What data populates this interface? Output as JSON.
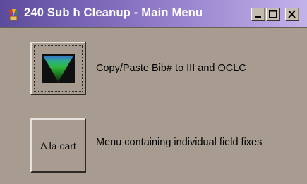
{
  "window": {
    "title": "240 Sub h Cleanup - Main Menu",
    "titlebar_icon": "app-icon",
    "controls": [
      "minimize-icon",
      "maximize-icon",
      "close-icon"
    ]
  },
  "menu": {
    "items": [
      {
        "button_icon": "green-triangle-icon",
        "button_label": "",
        "description": "Copy/Paste Bib# to III and OCLC"
      },
      {
        "button_icon": "",
        "button_label": "A la cart",
        "description": "Menu containing individual field fixes"
      }
    ]
  },
  "colors": {
    "window_bg": "#a89c90",
    "titlebar_start": "#5c4b9c",
    "titlebar_end": "#c2b2ea",
    "triangle_green": "#2bb838",
    "triangle_blue": "#3a6fd0"
  }
}
